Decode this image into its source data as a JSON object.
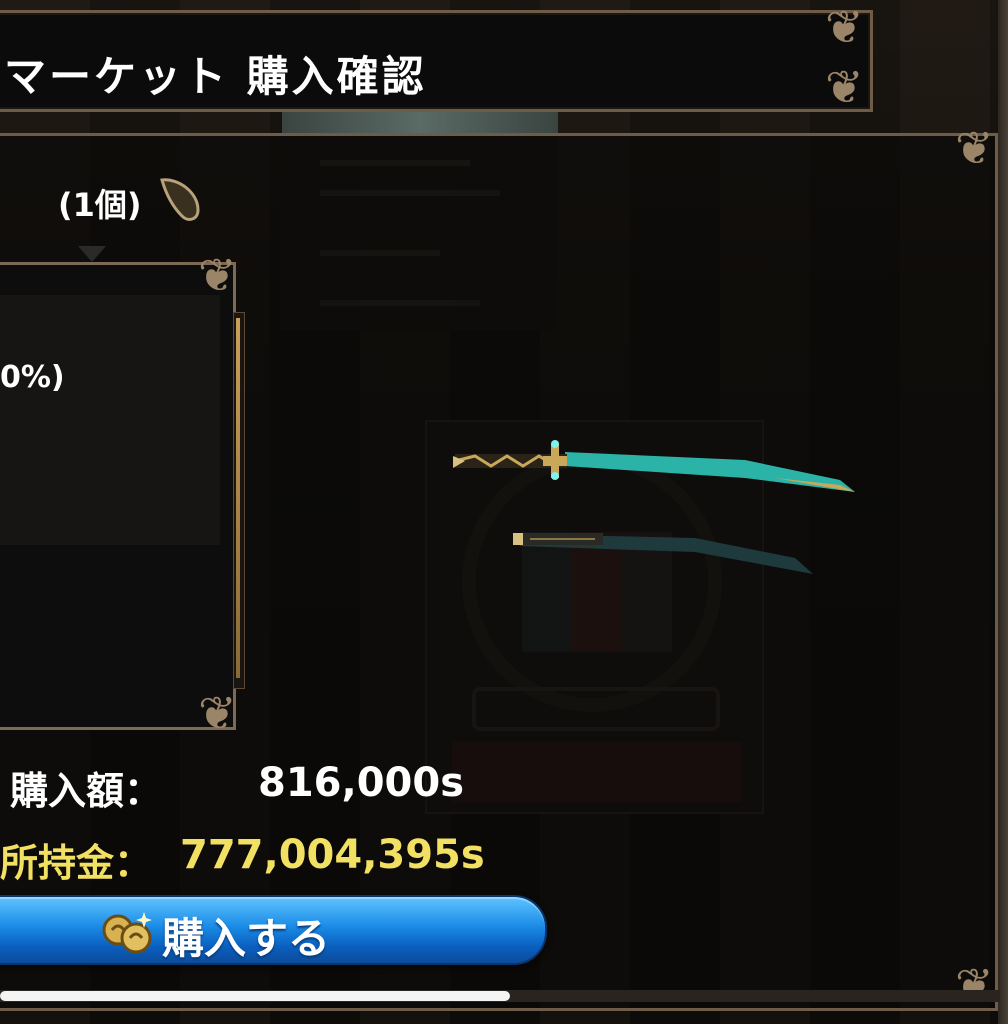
{
  "header": {
    "title": "マーケット 購入確認"
  },
  "item": {
    "quantity_label": "(1個)",
    "icon": "seed-icon",
    "description_fragment": "0%)"
  },
  "purchase": {
    "price_label": "購入額：",
    "price_value": "816,000s",
    "money_label": "所持金：",
    "money_value": "777,004,395s",
    "buy_button_label": "購入する",
    "buy_button_icon": "coins-icon"
  },
  "progress": {
    "fraction": 0.51
  },
  "colors": {
    "accent_blue": "#1a8be6",
    "money_yellow": "#f2e062",
    "frame_bronze": "#6e5c48",
    "blade_teal": "#2bb3a8"
  }
}
